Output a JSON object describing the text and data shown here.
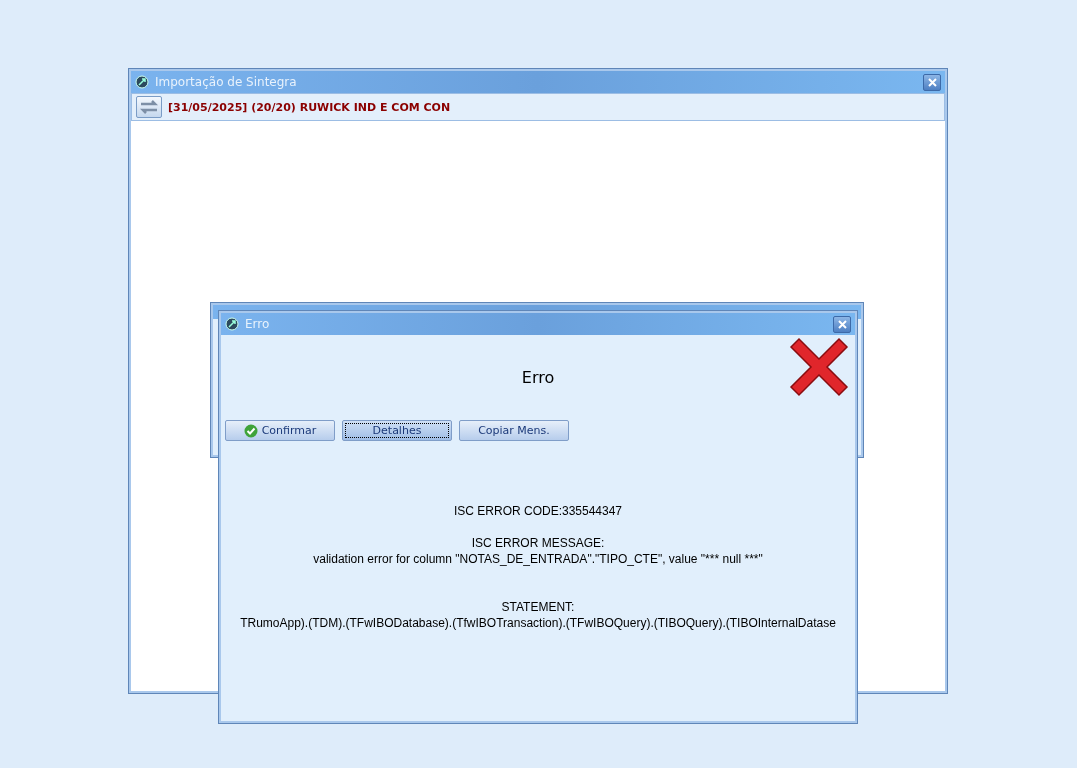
{
  "main_window": {
    "title": "Importação de Sintegra",
    "status_text": "[31/05/2025] (20/20) RUWICK IND E COM CON"
  },
  "error_dialog": {
    "title": "Erro",
    "heading": "Erro",
    "buttons": [
      {
        "label": "Confirmar",
        "kind": "confirm",
        "focused": false
      },
      {
        "label": "Detalhes",
        "kind": "plain",
        "focused": true
      },
      {
        "label": "Copiar Mens.",
        "kind": "plain",
        "focused": false
      }
    ],
    "details": [
      {
        "kind": "line",
        "text": "ISC ERROR CODE:335544347"
      },
      {
        "kind": "gap"
      },
      {
        "kind": "line",
        "text": "ISC ERROR MESSAGE:"
      },
      {
        "kind": "line",
        "text": "validation error for column \"NOTAS_DE_ENTRADA\".\"TIPO_CTE\", value \"*** null ***\""
      },
      {
        "kind": "gap"
      },
      {
        "kind": "gap"
      },
      {
        "kind": "line",
        "text": "STATEMENT:"
      },
      {
        "kind": "line",
        "text": "TRumoApp).(TDM).(TFwIBODatabase).(TfwIBOTransaction).(TFwIBOQuery).(TIBOQuery).(TIBOInternalDatase"
      }
    ]
  }
}
